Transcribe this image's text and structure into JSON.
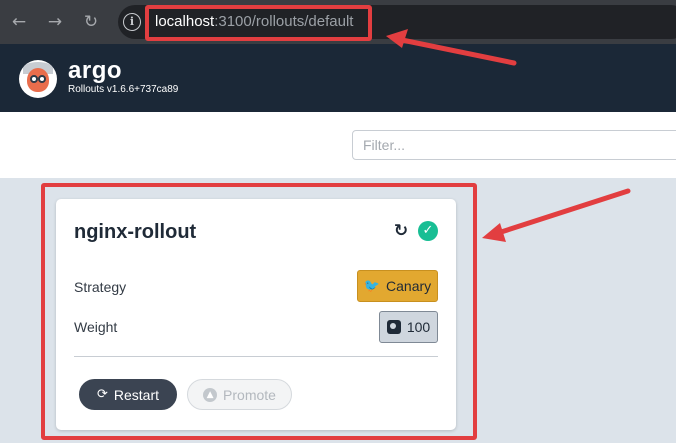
{
  "browser": {
    "url_host": "localhost",
    "url_path": ":3100/rollouts/default"
  },
  "header": {
    "brand": "argo",
    "version": "Rollouts v1.6.6+737ca89"
  },
  "filter": {
    "placeholder": "Filter..."
  },
  "rollout": {
    "name": "nginx-rollout",
    "strategy_label": "Strategy",
    "strategy_value": "Canary",
    "weight_label": "Weight",
    "weight_value": "100",
    "restart_label": "Restart",
    "promote_label": "Promote",
    "status": "healthy"
  },
  "icons": {
    "back": "arrow-left-icon",
    "forward": "arrow-right-icon",
    "reload": "reload-icon",
    "info": "info-icon",
    "refresh": "refresh-icon",
    "status": "check-circle-icon",
    "canary": "bird-icon",
    "weight": "weight-icon",
    "restart": "sync-icon",
    "promote": "chevron-up-circle-icon"
  },
  "colors": {
    "annotation": "#e23e40",
    "header_bg": "#1b2837",
    "canary_badge": "#e2a830",
    "status_green": "#18be94"
  }
}
